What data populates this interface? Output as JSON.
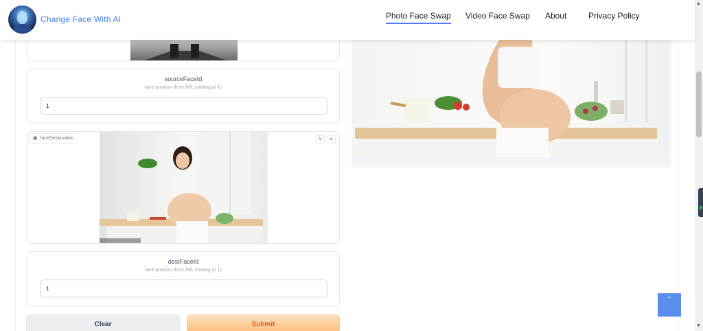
{
  "header": {
    "site_title": "Change Face With AI",
    "nav": [
      {
        "label": "Photo Face Swap",
        "active": true
      },
      {
        "label": "Video Face Swap",
        "active": false
      },
      {
        "label": "About",
        "active": false
      },
      {
        "label": "Privacy Policy",
        "active": false
      }
    ]
  },
  "source_face": {
    "label": "sourceFaceId",
    "info": "face position (from left, starting at 1)",
    "value": "1"
  },
  "face_destination": {
    "tag_label": "faceDestination",
    "edit_icon": "pencil-icon",
    "close_icon": "close-icon"
  },
  "dest_face": {
    "label": "destFaceId",
    "info": "face position (from left, starting at 1)",
    "value": "1"
  },
  "buttons": {
    "clear_label": "Clear",
    "submit_label": "Submit"
  },
  "scroll_top": {
    "label": "ˆ"
  },
  "colors": {
    "accent": "#3b82f6",
    "nav_underline": "#4f7cf7",
    "submit_text": "#ea580c",
    "scroll_top_bg": "#5b8def"
  }
}
